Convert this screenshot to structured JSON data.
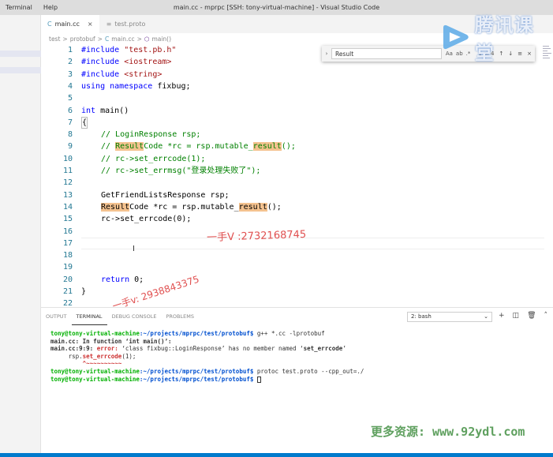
{
  "menu": [
    "Terminal",
    "Help"
  ],
  "window_title": "main.cc - mprpc [SSH: tony-virtual-machine] - Visual Studio Code",
  "tabs": [
    {
      "label": "main.cc",
      "icon": "c-file-icon",
      "active": true,
      "close": "×"
    },
    {
      "label": "test.proto",
      "icon": "file-icon",
      "active": false,
      "close": ""
    }
  ],
  "breadcrumb": [
    "test",
    ">",
    "protobuf",
    ">",
    "main.cc",
    ">",
    "main()"
  ],
  "find_widget": {
    "value": "Result",
    "match_case": "Aa",
    "whole_word": "ab",
    "regex": ".*",
    "count": "1 of 4"
  },
  "line_numbers": [
    "1",
    "2",
    "3",
    "4",
    "5",
    "6",
    "7",
    "8",
    "9",
    "10",
    "11",
    "12",
    "13",
    "14",
    "15",
    "16",
    "17",
    "18",
    "19",
    "20",
    "21",
    "22"
  ],
  "code": {
    "l1_kw": "#include",
    "l1_str": "\"test.pb.h\"",
    "l2_kw": "#include",
    "l2_str": "<iostream>",
    "l3_kw": "#include",
    "l3_str": "<string>",
    "l4_kw1": "using",
    "l4_kw2": "namespace",
    "l4_rest": "fixbug;",
    "l6_kw": "int",
    "l6_rest": "main()",
    "l7": "{",
    "l8": "// LoginResponse rsp;",
    "l9_a": "// ",
    "l9_hl": "Result",
    "l9_b": "Code *rc = rsp.mutable_",
    "l9_hl2": "result",
    "l9_c": "();",
    "l10": "// rc->set_errcode(1);",
    "l11": "// rc->set_errmsg(\"登录处理失败了\");",
    "l13": "GetFriendListsResponse rsp;",
    "l14_hl": "Result",
    "l14_a": "Code *rc = rsp.mutable_",
    "l14_hl2": "result",
    "l14_b": "();",
    "l15": "rc->set_errcode(0);",
    "l20_kw": "return",
    "l20_rest": "0;",
    "l21": "}"
  },
  "panel_tabs": [
    "OUTPUT",
    "TERMINAL",
    "DEBUG CONSOLE",
    "PROBLEMS"
  ],
  "terminal_select": "2: bash",
  "terminal": {
    "prompt_user": "tony@tony-virtual-machine",
    "prompt_path": ":~/projects/mprpc/test/protobuf$",
    "cmd1": " g++ *.cc -lprotobuf",
    "line2": "main.cc: In function ‘int main()’:",
    "line3_a": "main.cc:9:9: ",
    "line3_err": "error: ",
    "line3_b": "‘class fixbug::LoginResponse’ has no member named ‘",
    "line3_bold": "set_errcode",
    "line3_c": "’",
    "line4_a": "     rsp.",
    "line4_err": "set_errcode",
    "line4_b": "(1);",
    "line5": "         ^~~~~~~~~~~",
    "cmd2": " protoc test.proto --cpp_out=./"
  },
  "watermarks": {
    "w1": "一手V :2732168745",
    "w2": "一手v: 2938843375",
    "w3": "更多资源: www.92ydl.com",
    "logo": "腾讯课堂"
  },
  "colors": {
    "accent": "#007acc",
    "keyword": "#0000ff",
    "string": "#a31515",
    "comment": "#008000",
    "highlight": "#f4c28f"
  }
}
